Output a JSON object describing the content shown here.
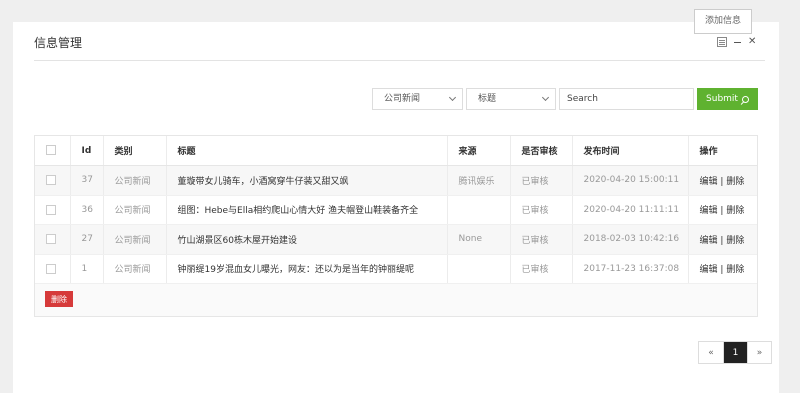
{
  "panel": {
    "title": "信息管理",
    "tooltip": "添加信息"
  },
  "icons": [
    "document-icon",
    "minimize-icon",
    "close-icon",
    "search-icon"
  ],
  "filters": {
    "category_select": "公司新闻",
    "field_select": "标题",
    "search_placeholder": "Search",
    "submit_label": "Submit"
  },
  "table": {
    "headers": {
      "id": "Id",
      "category": "类别",
      "title": "标题",
      "source": "来源",
      "audit": "是否审核",
      "publish_time": "发布时间",
      "actions": "操作"
    },
    "rows": [
      {
        "id": "37",
        "category": "公司新闻",
        "title": "董璇带女儿骑车，小酒窝穿牛仔装又甜又飒",
        "source": "腾讯娱乐",
        "audit": "已审核",
        "publish_time": "2020-04-20 15:00:11",
        "edit": "编辑",
        "sep": "|",
        "del": "删除"
      },
      {
        "id": "36",
        "category": "公司新闻",
        "title": "组图：Hebe与Ella相约爬山心情大好 渔夫帽登山鞋装备齐全",
        "source": "",
        "audit": "已审核",
        "publish_time": "2020-04-20 11:11:11",
        "edit": "编辑",
        "sep": "|",
        "del": "删除"
      },
      {
        "id": "27",
        "category": "公司新闻",
        "title": "竹山湖景区60栋木屋开始建设",
        "source": "None",
        "audit": "已审核",
        "publish_time": "2018-02-03 10:42:16",
        "edit": "编辑",
        "sep": "|",
        "del": "删除"
      },
      {
        "id": "1",
        "category": "公司新闻",
        "title": "钟丽缇19岁混血女儿曝光，网友：还以为是当年的钟丽缇呢",
        "source": "",
        "audit": "已审核",
        "publish_time": "2017-11-23 16:37:08",
        "edit": "编辑",
        "sep": "|",
        "del": "删除"
      }
    ],
    "delete_button": "删除"
  },
  "pagination": {
    "prev": "«",
    "current": "1",
    "next": "»"
  }
}
